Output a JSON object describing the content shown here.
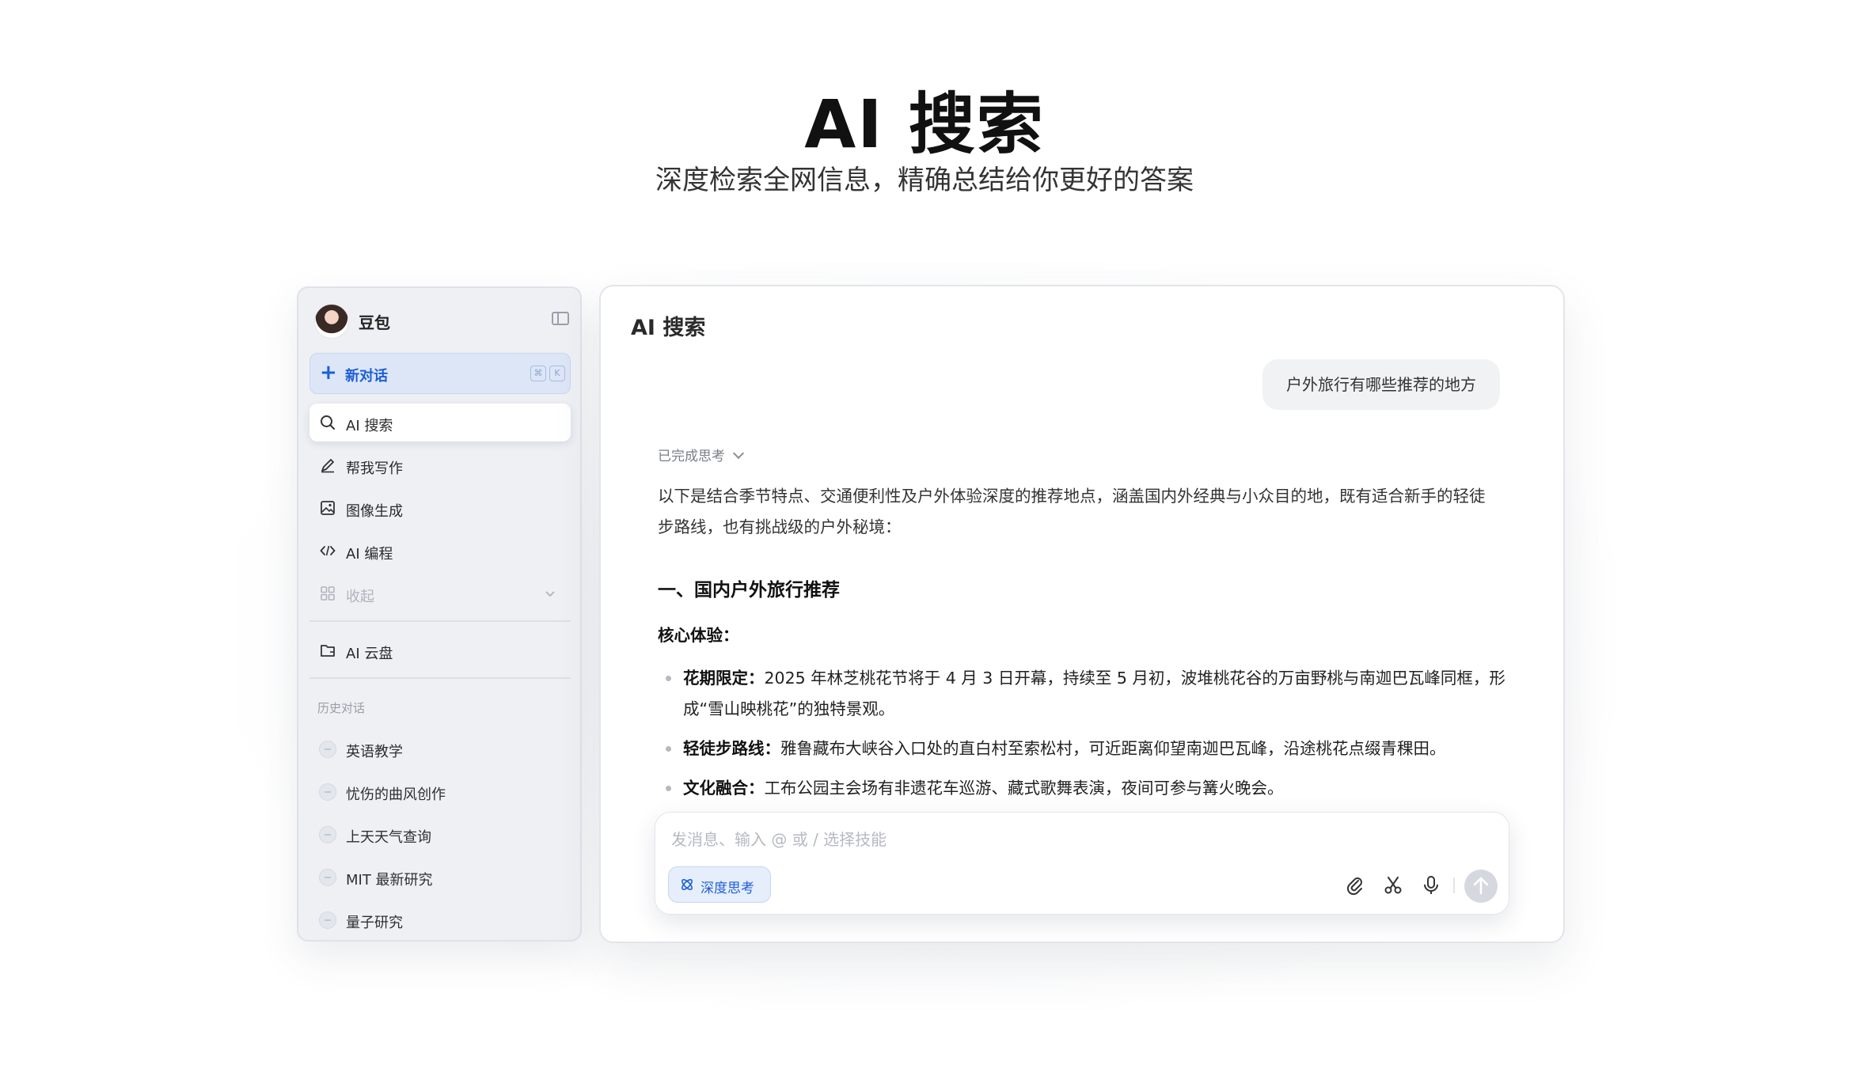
{
  "hero": {
    "title": "AI 搜索",
    "subtitle": "深度检索全网信息，精确总结给你更好的答案"
  },
  "sidebar": {
    "app_name": "豆包",
    "new_chat": {
      "label": "新对话",
      "shortcut": [
        "⌘",
        "K"
      ]
    },
    "nav_items": [
      {
        "label": "AI 搜索",
        "icon": "search-sparkle-icon",
        "active": true
      },
      {
        "label": "帮我写作",
        "icon": "pen-icon",
        "active": false
      },
      {
        "label": "图像生成",
        "icon": "image-icon",
        "active": false
      },
      {
        "label": "AI 编程",
        "icon": "code-icon",
        "active": false
      },
      {
        "label": "收起",
        "icon": "grid-icon",
        "active": false
      }
    ],
    "cloud_item": {
      "label": "AI 云盘",
      "icon": "cloud-folder-icon"
    },
    "history_label": "历史对话",
    "history": [
      {
        "label": "英语教学"
      },
      {
        "label": "忧伤的曲风创作"
      },
      {
        "label": "上天天气查询"
      },
      {
        "label": "MIT 最新研究"
      },
      {
        "label": "量子研究"
      }
    ]
  },
  "main": {
    "title": "AI 搜索",
    "user_message": "户外旅行有哪些推荐的地方",
    "thinking_label": "已完成思考",
    "answer": {
      "intro": "以下是结合季节特点、交通便利性及户外体验深度的推荐地点，涵盖国内外经典与小众目的地，既有适合新手的轻徒步路线，也有挑战级的户外秘境：",
      "h2": "一、国内户外旅行推荐",
      "h3": "核心体验：",
      "bullets": [
        {
          "term": "花期限定：",
          "text": "2025 年林芝桃花节将于 4 月 3 日开幕，持续至 5 月初，波堆桃花谷的万亩野桃与南迦巴瓦峰同框，形成“雪山映桃花”的独特景观。"
        },
        {
          "term": "轻徒步路线：",
          "text": "雅鲁藏布大峡谷入口处的直白村至索松村，可近距离仰望南迦巴瓦峰，沿途桃花点缀青稞田。"
        },
        {
          "term": "文化融合：",
          "text": "工布公园主会场有非遗花车巡游、藏式歌舞表演，夜间可参与篝火晚会。"
        }
      ]
    },
    "composer": {
      "placeholder": "发消息、输入 @ 或 / 选择技能",
      "value": "",
      "deep_think_label": "深度思考"
    }
  },
  "colors": {
    "accent": "#1e5fd6",
    "sidebar_bg": "#eef0f4",
    "new_chat_bg": "#dde6f6",
    "send_disabled": "#d5d8de"
  }
}
